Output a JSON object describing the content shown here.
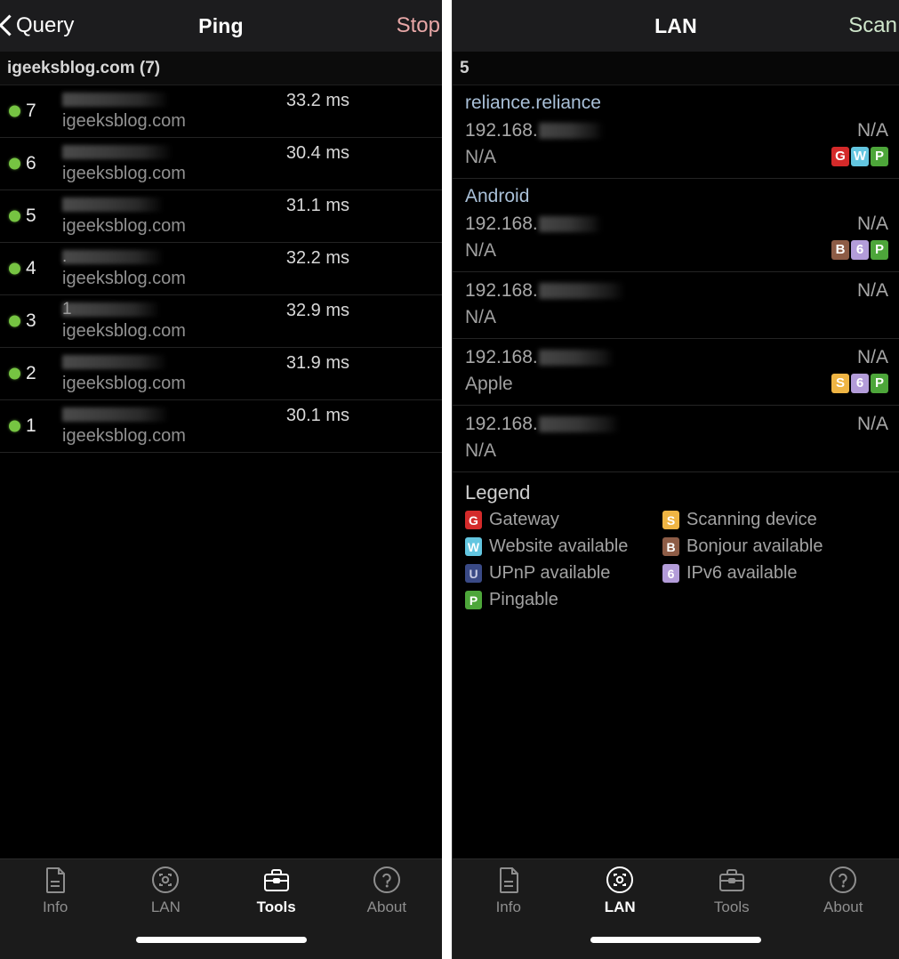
{
  "left_screen": {
    "navbar": {
      "back_label": "Query",
      "title": "Ping",
      "action_label": "Stop",
      "action_color": "#e8a7a7"
    },
    "section_header": "igeeksblog.com (7)",
    "ping_rows": [
      {
        "seq": "7",
        "ip_masked": "",
        "host": "igeeksblog.com",
        "latency": "33.2 ms",
        "status_color": "#76c442"
      },
      {
        "seq": "6",
        "ip_masked": "",
        "host": "igeeksblog.com",
        "latency": "30.4 ms",
        "status_color": "#76c442"
      },
      {
        "seq": "5",
        "ip_masked": "",
        "host": "igeeksblog.com",
        "latency": "31.1 ms",
        "status_color": "#76c442"
      },
      {
        "seq": "4",
        "ip_masked": ".",
        "host": "igeeksblog.com",
        "latency": "32.2 ms",
        "status_color": "#76c442"
      },
      {
        "seq": "3",
        "ip_masked": "1",
        "host": "igeeksblog.com",
        "latency": "32.9 ms",
        "status_color": "#76c442"
      },
      {
        "seq": "2",
        "ip_masked": "",
        "host": "igeeksblog.com",
        "latency": "31.9 ms",
        "status_color": "#76c442"
      },
      {
        "seq": "1",
        "ip_masked": "",
        "host": "igeeksblog.com",
        "latency": "30.1 ms",
        "status_color": "#76c442"
      }
    ],
    "tabbar": {
      "tabs": [
        {
          "label": "Info",
          "icon": "document-icon",
          "active": false
        },
        {
          "label": "LAN",
          "icon": "scan-icon",
          "active": false
        },
        {
          "label": "Tools",
          "icon": "briefcase-icon",
          "active": true
        },
        {
          "label": "About",
          "icon": "question-circle-icon",
          "active": false
        }
      ]
    }
  },
  "right_screen": {
    "navbar": {
      "title": "LAN",
      "action_label": "Scan",
      "action_color": "#cfe6cb"
    },
    "section_header": "5",
    "devices": [
      {
        "name": "reliance.reliance",
        "ip_prefix": "192.168.",
        "ip_masked": true,
        "vendor": "N/A",
        "right_value": "N/A",
        "badges": [
          "G",
          "W",
          "P"
        ]
      },
      {
        "name": "Android",
        "ip_prefix": "192.168.",
        "ip_masked": true,
        "vendor": "N/A",
        "right_value": "N/A",
        "badges": [
          "B",
          "6",
          "P"
        ]
      },
      {
        "name": "",
        "ip_prefix": "192.168.",
        "ip_masked": true,
        "vendor": "N/A",
        "right_value": "N/A",
        "badges": []
      },
      {
        "name": "",
        "ip_prefix": "192.168.",
        "ip_masked": true,
        "vendor": "Apple",
        "right_value": "N/A",
        "badges": [
          "S",
          "6",
          "P"
        ]
      },
      {
        "name": "",
        "ip_prefix": "192.168.",
        "ip_masked": true,
        "vendor": "N/A",
        "right_value": "N/A",
        "badges": []
      }
    ],
    "legend": {
      "title": "Legend",
      "items": [
        {
          "key": "G",
          "label": "Gateway",
          "color": "#d42a2a",
          "text_color": "#ffffff"
        },
        {
          "key": "S",
          "label": "Scanning device",
          "color": "#efb544",
          "text_color": "#ffffff"
        },
        {
          "key": "W",
          "label": "Website available",
          "color": "#63c6e0",
          "text_color": "#ffffff"
        },
        {
          "key": "B",
          "label": "Bonjour available",
          "color": "#8d5c46",
          "text_color": "#ffffff"
        },
        {
          "key": "U",
          "label": "UPnP available",
          "color": "#3a4a86",
          "text_color": "#c8cce4"
        },
        {
          "key": "6",
          "label": "IPv6 available",
          "color": "#b39cd9",
          "text_color": "#ffffff"
        },
        {
          "key": "P",
          "label": "Pingable",
          "color": "#4da63a",
          "text_color": "#ffffff"
        }
      ]
    },
    "tabbar": {
      "tabs": [
        {
          "label": "Info",
          "icon": "document-icon",
          "active": false
        },
        {
          "label": "LAN",
          "icon": "scan-icon",
          "active": true
        },
        {
          "label": "Tools",
          "icon": "briefcase-icon",
          "active": false
        },
        {
          "label": "About",
          "icon": "question-circle-icon",
          "active": false
        }
      ]
    }
  },
  "badge_colors": {
    "G": "#d42a2a",
    "W": "#63c6e0",
    "U": "#3a4a86",
    "P": "#4da63a",
    "S": "#efb544",
    "B": "#8d5c46",
    "6": "#b39cd9"
  }
}
